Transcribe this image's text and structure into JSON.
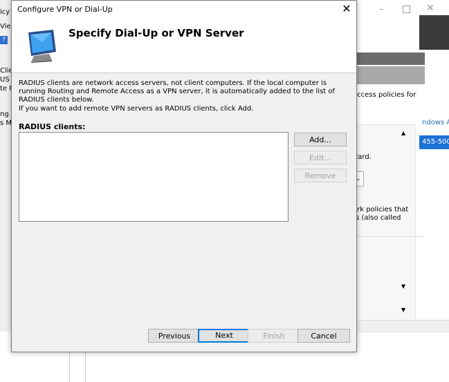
{
  "background": {
    "left_fragments": [
      "icy",
      "Vie",
      "?",
      "Clie",
      "US C",
      "te F",
      "ng",
      "s M"
    ],
    "right_text_1": "access policies for",
    "right_link": "ndows A",
    "right_selected": "455-500",
    "right_text_2": "zard.",
    "right_text_3a": "ork policies that",
    "right_text_3b": "rs (also called"
  },
  "dialog": {
    "title": "Configure VPN or Dial-Up",
    "close_glyph": "✕",
    "page_title": "Specify Dial-Up or VPN Server",
    "description_1": "RADIUS clients are network access servers, not client computers. If the local computer is running Routing and Remote Access as a VPN server, it is automatically added to the list of RADIUS clients below.",
    "description_2": "If you want to add remote VPN servers as RADIUS clients, click Add.",
    "clients_label": "RADIUS clients:",
    "clients": [],
    "side_buttons": {
      "add": "Add...",
      "edit": "Edit...",
      "remove": "Remove"
    },
    "footer_buttons": {
      "previous": "Previous",
      "next": "Next",
      "finish": "Finish",
      "cancel": "Cancel"
    },
    "header_icon": "computer-monitor-icon"
  }
}
